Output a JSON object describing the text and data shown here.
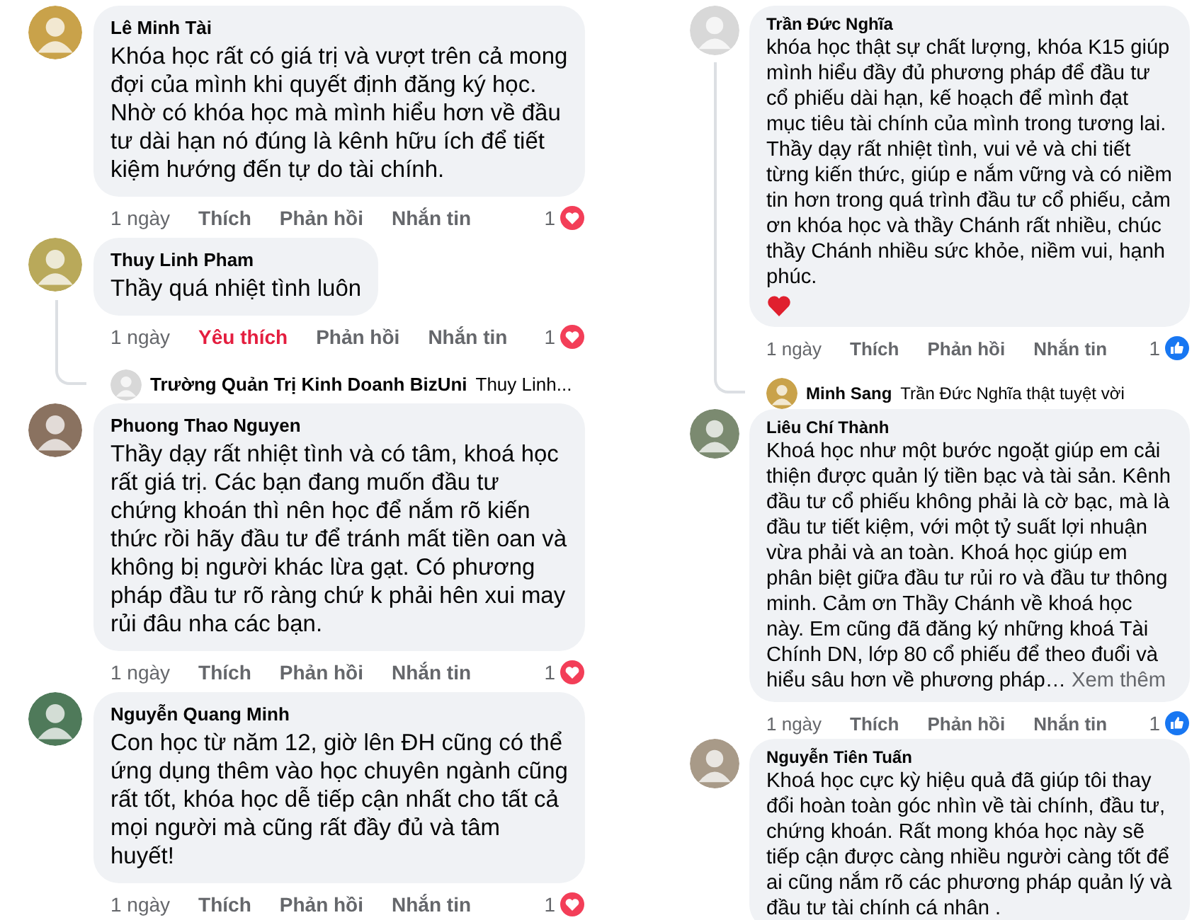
{
  "columns": [
    {
      "comments": [
        {
          "name": "Lê Minh Tài",
          "text": "Khóa học rất có giá trị và vượt trên cả mong đợi của mình khi quyết định đăng ký học. Nhờ có khóa học mà mình hiểu hơn về đầu tư dài hạn nó đúng là kênh hữu ích để tiết kiệm hướng đến tự do tài chính.",
          "actions": {
            "time": "1 ngày",
            "like": "Thích",
            "liked": false,
            "reply": "Phản hồi",
            "message": "Nhắn tin",
            "count": "1",
            "reaction": {
              "kind": "love"
            }
          }
        },
        {
          "name": "Thuy Linh Pham",
          "text": "Thầy quá nhiệt tình luôn",
          "actions": {
            "time": "1 ngày",
            "like": "Yêu thích",
            "liked": true,
            "reply": "Phản hồi",
            "message": "Nhắn tin",
            "count": "1",
            "reaction": {
              "kind": "love"
            }
          },
          "reply_preview": {
            "name": "Trường Quản Trị Kinh Doanh BizUni",
            "text": "Thuy Linh..."
          }
        },
        {
          "name": "Phuong Thao Nguyen",
          "text": "Thầy dạy rất nhiệt tình và có tâm, khoá học rất giá trị. Các bạn đang muốn đầu tư chứng khoán thì nên học để nắm rõ kiến thức rồi hãy đầu tư để tránh mất tiền oan và không bị người khác lừa gạt. Có phương pháp đầu tư rõ ràng chứ k phải hên xui may rủi đâu nha các bạn.",
          "actions": {
            "time": "1 ngày",
            "like": "Thích",
            "liked": false,
            "reply": "Phản hồi",
            "message": "Nhắn tin",
            "count": "1",
            "reaction": {
              "kind": "love"
            }
          }
        },
        {
          "name": "Nguyễn Quang Minh",
          "text": "Con học từ năm 12, giờ lên ĐH cũng có thể ứng dụng thêm vào học chuyên ngành cũng rất tốt, khóa học dễ tiếp cận nhất cho tất cả mọi người mà cũng rất đầy đủ và tâm huyết!",
          "actions": {
            "time": "1 ngày",
            "like": "Thích",
            "liked": false,
            "reply": "Phản hồi",
            "message": "Nhắn tin",
            "count": "1",
            "reaction": {
              "kind": "love"
            }
          }
        }
      ]
    },
    {
      "comments": [
        {
          "name": "Trần Đức Nghĩa",
          "text": "khóa học thật sự chất lượng, khóa K15 giúp mình hiểu đầy đủ phương pháp để đầu tư cổ phiếu dài hạn, kế hoạch để mình đạt mục tiêu tài chính của mình trong tương lai. Thầy dạy rất nhiệt tình, vui vẻ và chi tiết từng kiến thức, giúp e nắm vững và có niềm tin hơn trong quá trình đầu tư cổ phiếu, cảm ơn khóa học và thầy Chánh rất nhiều, chúc thầy Chánh nhiều sức khỏe, niềm vui, hạnh phúc.",
          "emoji": {
            "kind": "heart"
          },
          "actions": {
            "time": "1 ngày",
            "like": "Thích",
            "liked": false,
            "reply": "Phản hồi",
            "message": "Nhắn tin",
            "count": "1",
            "reaction": {
              "kind": "like"
            }
          },
          "reply_preview": {
            "name": "Minh Sang",
            "text": "Trần Đức Nghĩa thật tuyệt vời"
          }
        },
        {
          "name": "Liêu Chí Thành",
          "text": "Khoá học như một bước ngoặt giúp em cải thiện được quản lý tiền bạc và tài sản. Kênh đầu tư cổ phiếu không phải là cờ bạc, mà là đầu tư tiết kiệm, với một tỷ suất lợi nhuận vừa phải và an toàn. Khoá học giúp em phân biệt giữa đầu tư rủi ro và đầu tư thông minh. Cảm ơn Thầy Chánh về khoá học này. Em cũng đã đăng ký những khoá Tài Chính DN, lớp 80 cổ phiếu để theo đuổi và hiểu sâu hơn về phương pháp…",
          "see_more": "Xem thêm",
          "actions": {
            "time": "1 ngày",
            "like": "Thích",
            "liked": false,
            "reply": "Phản hồi",
            "message": "Nhắn tin",
            "count": "1",
            "reaction": {
              "kind": "like"
            }
          }
        },
        {
          "name": "Nguyễn Tiên Tuấn",
          "text": "Khoá học cực kỳ hiệu quả đã giúp tôi thay đổi hoàn toàn góc nhìn về tài chính, đầu tư, chứng khoán. Rất mong khóa học này sẽ tiếp cận được càng nhiều người càng tốt để ai cũng nắm rõ các phương pháp quản lý và đầu tư tài chính cá nhân ."
        }
      ]
    }
  ]
}
